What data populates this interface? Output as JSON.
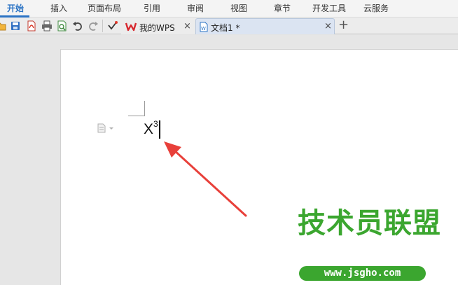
{
  "menu": {
    "items": [
      "开始",
      "插入",
      "页面布局",
      "引用",
      "审阅",
      "视图",
      "章节",
      "开发工具",
      "云服务"
    ],
    "active_index": 0
  },
  "quick_access": {
    "icons": [
      "open-folder-icon",
      "save-icon",
      "export-pdf-icon",
      "print-icon",
      "print-preview-icon",
      "undo-icon",
      "redo-icon",
      "customize-dropdown-icon"
    ]
  },
  "tabs": [
    {
      "label": "我的WPS",
      "close": "×",
      "icon": "wps-logo-icon",
      "active": false
    },
    {
      "label": "文档1 *",
      "close": "×",
      "icon": "document-icon",
      "active": true
    }
  ],
  "new_tab_label": "+",
  "document": {
    "base_text": "X",
    "superscript": "3"
  },
  "watermark": {
    "title": "技术员联盟",
    "url": "www.jsgho.com"
  },
  "colors": {
    "accent": "#2b73c4",
    "arrow": "#e8403a",
    "watermark": "#3ba62f"
  }
}
